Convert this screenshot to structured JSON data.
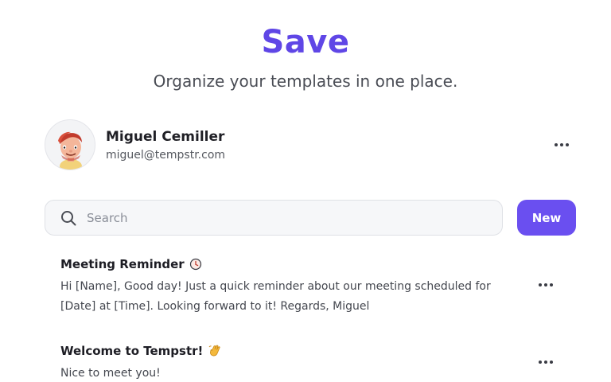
{
  "header": {
    "title": "Save",
    "subtitle": "Organize your templates in one place."
  },
  "profile": {
    "name": "Miguel Cemiller",
    "email": "miguel@tempstr.com",
    "avatar_icon": "user-avatar-3d-character"
  },
  "search": {
    "placeholder": "Search",
    "value": ""
  },
  "new_button": {
    "label": "New"
  },
  "templates": [
    {
      "title": "Meeting Reminder",
      "title_icon": "clock-icon",
      "body": "Hi [Name], Good day! Just a quick reminder about our meeting scheduled for [Date] at [Time]. Looking forward to it! Regards, Miguel"
    },
    {
      "title": "Welcome to Tempstr!",
      "title_icon": "waving-hand-icon",
      "body": "Nice to meet you!"
    }
  ],
  "colors": {
    "accent": "#5f46e6",
    "button": "#6a4ff0",
    "text": "#1d1d24",
    "muted": "#55585f"
  }
}
